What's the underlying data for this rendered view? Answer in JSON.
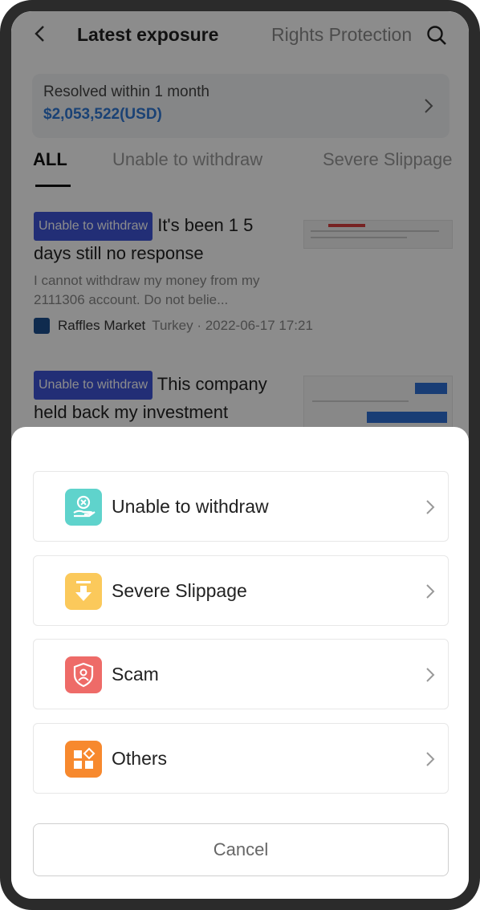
{
  "header": {
    "title": "Latest exposure",
    "tab_rights": "Rights Protection"
  },
  "summary": {
    "label": "Resolved within 1 month",
    "amount": "$2,053,522(USD)"
  },
  "filters": [
    "ALL",
    "Unable to withdraw",
    "Severe Slippage"
  ],
  "posts": [
    {
      "tag": "Unable to withdraw",
      "title": "It's been 1 5 days still no response",
      "body": "I cannot withdraw my money from my 2111306 account. Do not belie...",
      "broker": "Raffles Market",
      "meta": "Turkey · 2022-06-17 17:21"
    },
    {
      "tag": "Unable to withdraw",
      "title": "This company held back my investment",
      "body": "",
      "broker": "",
      "meta": ""
    }
  ],
  "sheet": {
    "options": [
      {
        "label": "Unable to withdraw",
        "icon": "hand-coin-icon",
        "color": "#5fd3cc"
      },
      {
        "label": "Severe Slippage",
        "icon": "down-arrow-icon",
        "color": "#fbc95b"
      },
      {
        "label": "Scam",
        "icon": "shield-user-icon",
        "color": "#ee6b68"
      },
      {
        "label": "Others",
        "icon": "grid-shapes-icon",
        "color": "#f7892e"
      }
    ],
    "cancel_label": "Cancel"
  }
}
